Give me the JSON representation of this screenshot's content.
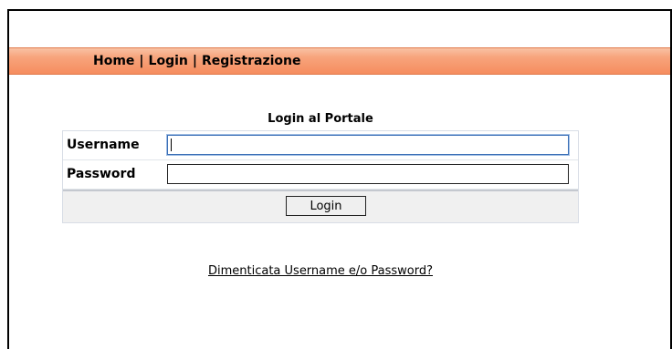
{
  "nav": {
    "links": [
      "Home",
      "Login",
      "Registrazione"
    ],
    "separator": "|"
  },
  "login_form": {
    "title": "Login al Portale",
    "username_label": "Username",
    "username_value": "",
    "password_label": "Password",
    "password_value": "",
    "submit_label": "Login",
    "forgot_link": "Dimenticata Username e/o Password?"
  },
  "colors": {
    "nav_bar": "#f68d5f",
    "focus_border": "#3b6fb6"
  }
}
